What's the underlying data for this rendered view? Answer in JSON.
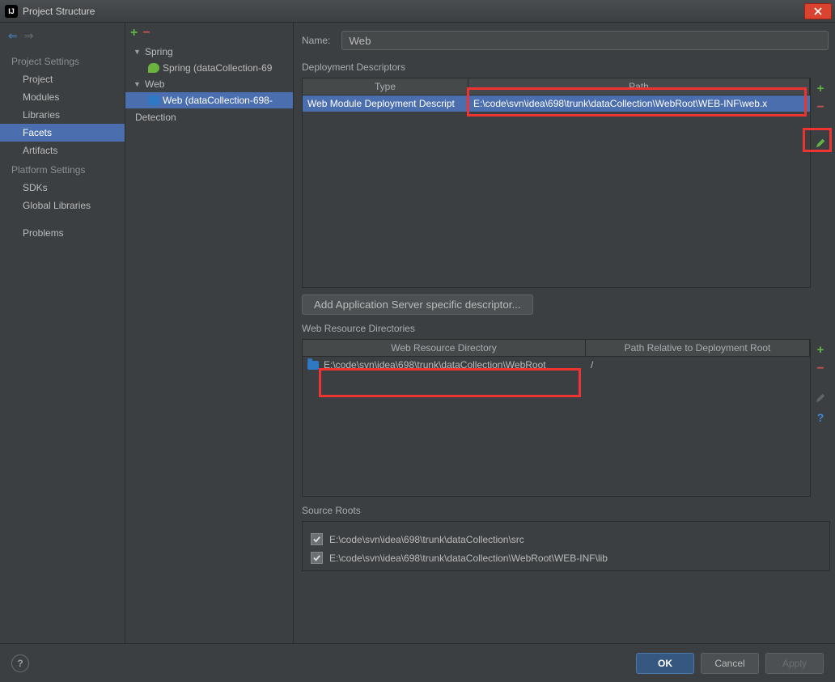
{
  "window": {
    "title": "Project Structure"
  },
  "sidebar": {
    "project_settings_label": "Project Settings",
    "platform_settings_label": "Platform Settings",
    "items": {
      "project": "Project",
      "modules": "Modules",
      "libraries": "Libraries",
      "facets": "Facets",
      "artifacts": "Artifacts",
      "sdks": "SDKs",
      "global_libraries": "Global Libraries",
      "problems": "Problems"
    }
  },
  "tree": {
    "spring": "Spring",
    "spring_child": "Spring (dataCollection-69",
    "web": "Web",
    "web_child": "Web (dataCollection-698-",
    "detection": "Detection"
  },
  "main": {
    "name_label": "Name:",
    "name_value": "Web",
    "deployment_descriptors_label": "Deployment Descriptors",
    "dd_headers": {
      "type": "Type",
      "path": "Path"
    },
    "dd_row": {
      "type": "Web Module Deployment Descript",
      "path": "E:\\code\\svn\\idea\\698\\trunk\\dataCollection\\WebRoot\\WEB-INF\\web.x"
    },
    "add_descriptor_btn": "Add Application Server specific descriptor...",
    "web_resource_label": "Web Resource Directories",
    "wr_headers": {
      "dir": "Web Resource Directory",
      "rel": "Path Relative to Deployment Root"
    },
    "wr_row": {
      "dir": "E:\\code\\svn\\idea\\698\\trunk\\dataCollection\\WebRoot",
      "rel": "/"
    },
    "source_roots_label": "Source Roots",
    "source_roots": [
      "E:\\code\\svn\\idea\\698\\trunk\\dataCollection\\src",
      "E:\\code\\svn\\idea\\698\\trunk\\dataCollection\\WebRoot\\WEB-INF\\lib"
    ]
  },
  "footer": {
    "ok": "OK",
    "cancel": "Cancel",
    "apply": "Apply"
  }
}
